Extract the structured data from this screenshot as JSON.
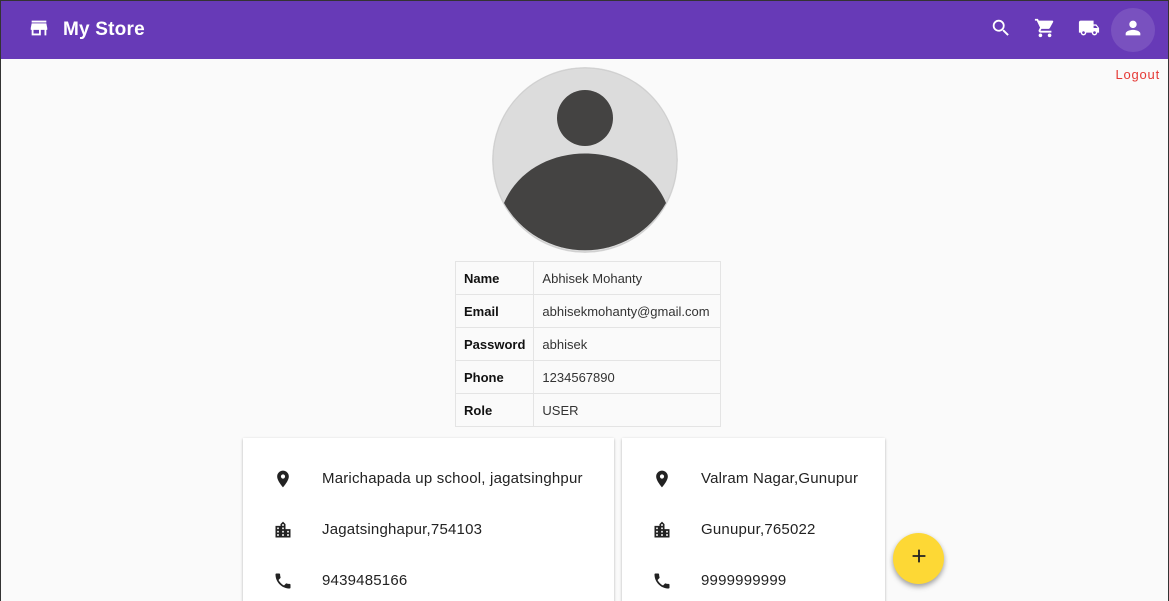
{
  "app": {
    "title": "My Store",
    "brand_icon": "store-icon",
    "actions": [
      {
        "name": "search-icon"
      },
      {
        "name": "shopping-cart-icon"
      },
      {
        "name": "local-shipping-icon"
      },
      {
        "name": "person-icon"
      }
    ]
  },
  "logout_label": "Logout",
  "profile": {
    "rows": [
      {
        "key": "Name",
        "value": "Abhisek Mohanty"
      },
      {
        "key": "Email",
        "value": "abhisekmohanty@gmail.com"
      },
      {
        "key": "Password",
        "value": "abhisek"
      },
      {
        "key": "Phone",
        "value": "1234567890"
      },
      {
        "key": "Role",
        "value": "USER"
      }
    ]
  },
  "addresses": [
    {
      "street": "Marichapada up school, jagatsinghpur",
      "city": "Jagatsinghapur,754103",
      "phone": "9439485166"
    },
    {
      "street": "Valram Nagar,Gunupur",
      "city": "Gunupur,765022",
      "phone": "9999999999"
    }
  ],
  "colors": {
    "toolbar": "#673ab7",
    "logout": "#e53935",
    "fab": "#fdd835"
  }
}
